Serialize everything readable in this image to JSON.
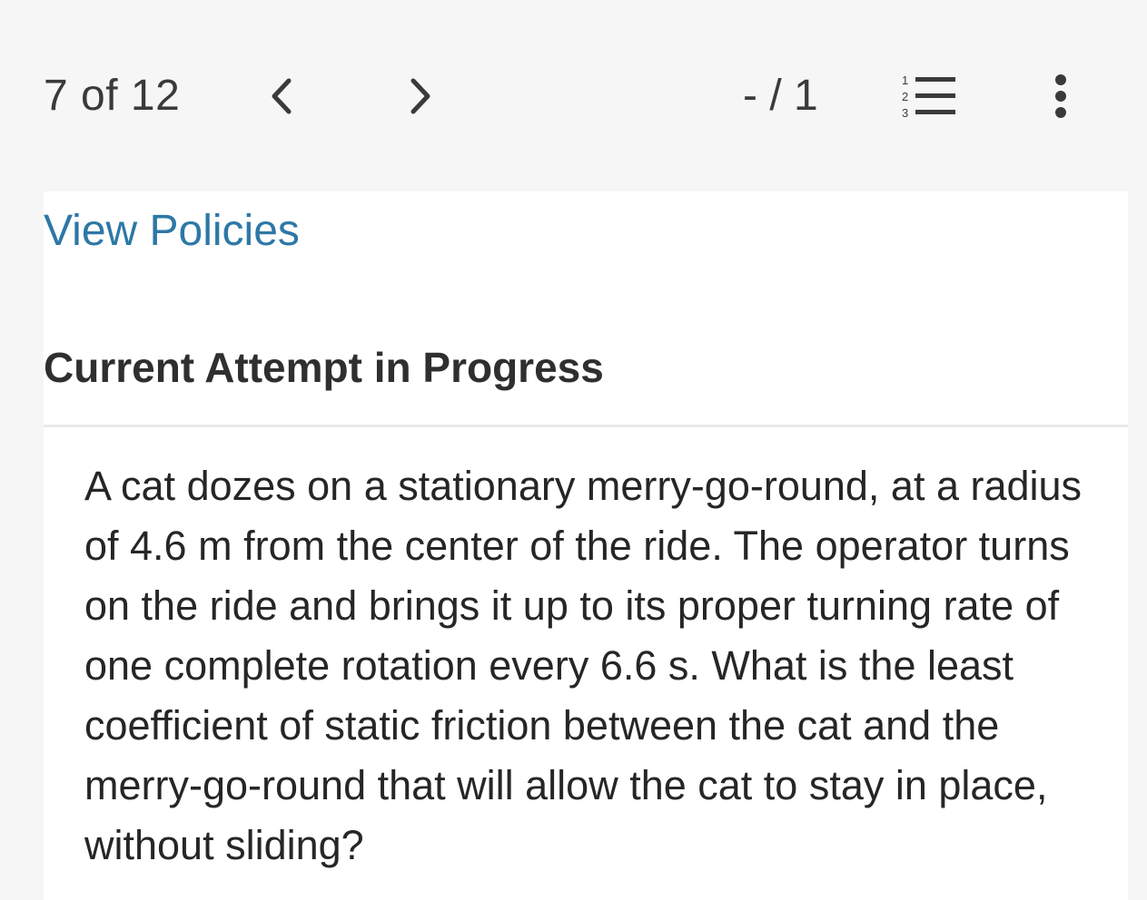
{
  "header": {
    "counter": "7 of 12",
    "prev_icon": "chevron-left-icon",
    "next_icon": "chevron-right-icon",
    "score": "- / 1",
    "list_icon": "numbered-list-icon",
    "list_icon_digits": [
      "1",
      "2",
      "3"
    ],
    "more_icon": "vertical-ellipsis-icon"
  },
  "panel": {
    "policies_link": "View Policies",
    "section_title": "Current Attempt in Progress",
    "question_text": "A cat dozes on a stationary merry-go-round, at a radius of 4.6 m from the center of the ride. The operator turns on the ride and brings it up to its proper turning rate of one complete rotation every 6.6 s. What is the least coefficient of static friction between the cat and the merry-go-round that will allow the cat to stay in place, without sliding?"
  },
  "colors": {
    "background": "#f6f6f6",
    "panel": "#ffffff",
    "link": "#2d78a6",
    "text": "#262626"
  }
}
